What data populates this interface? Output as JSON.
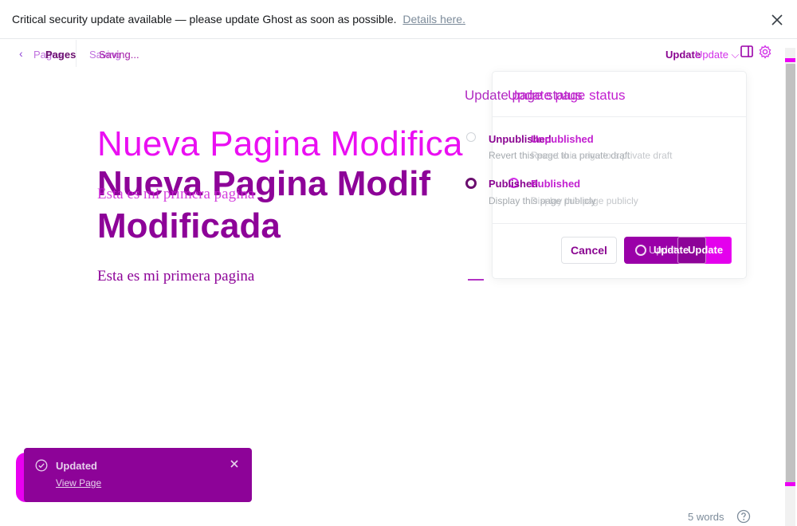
{
  "banner": {
    "message": "Critical security update available — please update Ghost as soon as possible.",
    "link_text": "Details here."
  },
  "header": {
    "breadcrumb_ghost": "Pages",
    "breadcrumb": "Pages",
    "status_ghost": "Saving",
    "status": "Saving...",
    "update_primary": "Update",
    "update_secondary": "Update"
  },
  "content": {
    "title_ghost": "Nueva Pagina Modifica",
    "title_line1": "Nueva Pagina Modif",
    "title_line2": "Modificada",
    "body_ghost": "Esta es mi primera pagina",
    "body": "Esta es mi primera pagina"
  },
  "popover": {
    "title_ghost": "Update page status",
    "title": "Update page status",
    "options": [
      {
        "label_a": "Unpublished",
        "label_b": "Unpublished",
        "desc_a": "Revert this page to a private draft",
        "desc_b": "Revert this page to a private draft",
        "checked": false
      },
      {
        "label_a": "Published",
        "label_b": "Published",
        "desc_a": "Display this page publicly",
        "desc_b": "Display this page publicly",
        "checked": true
      }
    ],
    "cancel_label": "Cancel",
    "update_ghost_label": "Update",
    "update_label": "Update",
    "update_label_2": "Update"
  },
  "toast": {
    "title": "Updated",
    "link": "View Page"
  },
  "footer": {
    "word_count": "5 words"
  },
  "colors": {
    "accent": "#8d0398",
    "accent_bright": "#ec00f4",
    "link_grey": "#7c8b9a"
  },
  "icons": [
    "close-icon",
    "chevron-left-icon",
    "sidebar-icon",
    "gear-icon",
    "check-circle-icon",
    "spinner-icon",
    "help-icon"
  ]
}
